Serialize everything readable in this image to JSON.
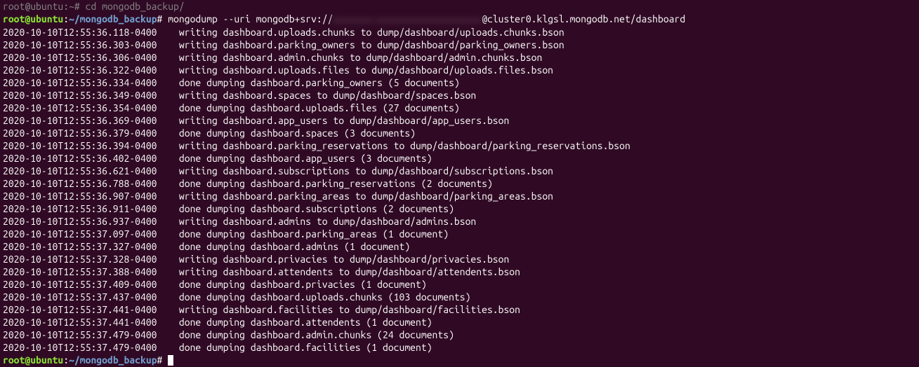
{
  "truncated_line": "root@ubuntu:~# cd mongodb_backup/",
  "prompt1": {
    "user_host": "root@ubuntu",
    "colon": ":",
    "path": "~/mongodb_backup",
    "hash": "# ",
    "cmd_pre": "mongodump --uri mongodb+srv://",
    "redacted": "xxxxxxx:xxxxxxxxxxxxxxxxxxx",
    "cmd_post": "@cluster0.klgsl.mongodb.net/dashboard"
  },
  "logs": [
    {
      "ts": "2020-10-10T12:55:36.118-0400",
      "pad": "    ",
      "msg": "writing dashboard.uploads.chunks to dump/dashboard/uploads.chunks.bson"
    },
    {
      "ts": "2020-10-10T12:55:36.303-0400",
      "pad": "    ",
      "msg": "writing dashboard.parking_owners to dump/dashboard/parking_owners.bson"
    },
    {
      "ts": "2020-10-10T12:55:36.306-0400",
      "pad": "    ",
      "msg": "writing dashboard.admin.chunks to dump/dashboard/admin.chunks.bson"
    },
    {
      "ts": "2020-10-10T12:55:36.322-0400",
      "pad": "    ",
      "msg": "writing dashboard.uploads.files to dump/dashboard/uploads.files.bson"
    },
    {
      "ts": "2020-10-10T12:55:36.334-0400",
      "pad": "    ",
      "msg": "done dumping dashboard.parking_owners (5 documents)"
    },
    {
      "ts": "2020-10-10T12:55:36.349-0400",
      "pad": "    ",
      "msg": "writing dashboard.spaces to dump/dashboard/spaces.bson"
    },
    {
      "ts": "2020-10-10T12:55:36.354-0400",
      "pad": "    ",
      "msg": "done dumping dashboard.uploads.files (27 documents)"
    },
    {
      "ts": "2020-10-10T12:55:36.369-0400",
      "pad": "    ",
      "msg": "writing dashboard.app_users to dump/dashboard/app_users.bson"
    },
    {
      "ts": "2020-10-10T12:55:36.379-0400",
      "pad": "    ",
      "msg": "done dumping dashboard.spaces (3 documents)"
    },
    {
      "ts": "2020-10-10T12:55:36.394-0400",
      "pad": "    ",
      "msg": "writing dashboard.parking_reservations to dump/dashboard/parking_reservations.bson"
    },
    {
      "ts": "2020-10-10T12:55:36.402-0400",
      "pad": "    ",
      "msg": "done dumping dashboard.app_users (3 documents)"
    },
    {
      "ts": "2020-10-10T12:55:36.621-0400",
      "pad": "    ",
      "msg": "writing dashboard.subscriptions to dump/dashboard/subscriptions.bson"
    },
    {
      "ts": "2020-10-10T12:55:36.788-0400",
      "pad": "    ",
      "msg": "done dumping dashboard.parking_reservations (2 documents)"
    },
    {
      "ts": "2020-10-10T12:55:36.907-0400",
      "pad": "    ",
      "msg": "writing dashboard.parking_areas to dump/dashboard/parking_areas.bson"
    },
    {
      "ts": "2020-10-10T12:55:36.911-0400",
      "pad": "    ",
      "msg": "done dumping dashboard.subscriptions (2 documents)"
    },
    {
      "ts": "2020-10-10T12:55:36.937-0400",
      "pad": "    ",
      "msg": "writing dashboard.admins to dump/dashboard/admins.bson"
    },
    {
      "ts": "2020-10-10T12:55:37.097-0400",
      "pad": "    ",
      "msg": "done dumping dashboard.parking_areas (1 document)"
    },
    {
      "ts": "2020-10-10T12:55:37.327-0400",
      "pad": "    ",
      "msg": "done dumping dashboard.admins (1 document)"
    },
    {
      "ts": "2020-10-10T12:55:37.328-0400",
      "pad": "    ",
      "msg": "writing dashboard.privacies to dump/dashboard/privacies.bson"
    },
    {
      "ts": "2020-10-10T12:55:37.388-0400",
      "pad": "    ",
      "msg": "writing dashboard.attendents to dump/dashboard/attendents.bson"
    },
    {
      "ts": "2020-10-10T12:55:37.409-0400",
      "pad": "    ",
      "msg": "done dumping dashboard.privacies (1 document)"
    },
    {
      "ts": "2020-10-10T12:55:37.437-0400",
      "pad": "    ",
      "msg": "done dumping dashboard.uploads.chunks (103 documents)"
    },
    {
      "ts": "2020-10-10T12:55:37.441-0400",
      "pad": "    ",
      "msg": "writing dashboard.facilities to dump/dashboard/facilities.bson"
    },
    {
      "ts": "2020-10-10T12:55:37.441-0400",
      "pad": "    ",
      "msg": "done dumping dashboard.attendents (1 document)"
    },
    {
      "ts": "2020-10-10T12:55:37.479-0400",
      "pad": "    ",
      "msg": "done dumping dashboard.admin.chunks (24 documents)"
    },
    {
      "ts": "2020-10-10T12:55:37.479-0400",
      "pad": "    ",
      "msg": "done dumping dashboard.facilities (1 document)"
    }
  ],
  "prompt2": {
    "user_host": "root@ubuntu",
    "colon": ":",
    "path": "~/mongodb_backup",
    "hash": "# "
  }
}
